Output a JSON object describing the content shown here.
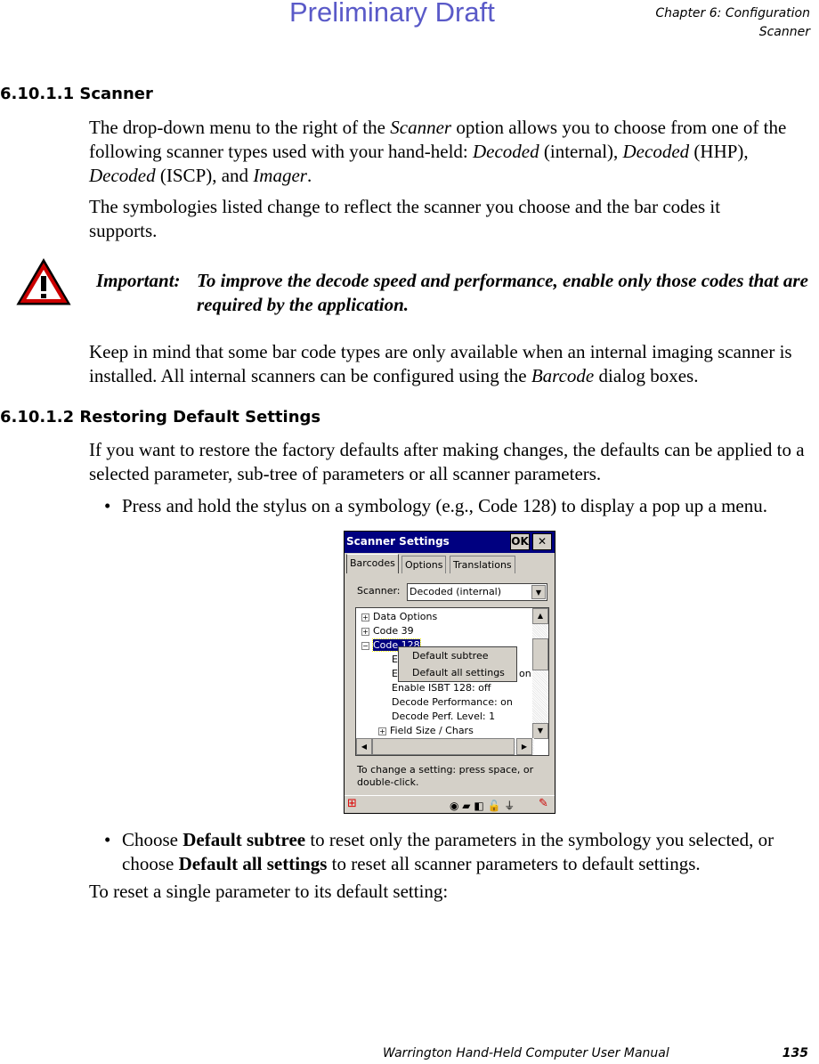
{
  "header": {
    "draft": "Preliminary Draft",
    "chapter": "Chapter 6:  Configuration",
    "section": "Scanner"
  },
  "s1": {
    "heading": "6.10.1.1  Scanner",
    "p1": [
      "The drop-down menu to the right of the ",
      "Scanner",
      " option allows you to choose from one of the following scanner types used with your hand-held: ",
      "Decoded",
      " (internal), ",
      "Decoded",
      " (HHP), ",
      "Decoded",
      " (ISCP), and ",
      "Imager",
      "."
    ],
    "p2": "The symbologies listed change to reflect the scanner you choose and the bar codes it supports.",
    "important_label": "Important:",
    "important_text": "To improve the decode speed and performance, enable only those codes that are required by the application.",
    "p3": [
      "Keep in mind that some bar code types are only available when an internal imaging scanner is installed. All internal scanners can be configured using the ",
      "Barcode",
      " dialog boxes."
    ]
  },
  "s2": {
    "heading": "6.10.1.2  Restoring Default Settings",
    "p1": "If you want to restore the factory defaults after making changes, the defaults can be applied to a selected parameter, sub-tree of parameters or all scanner parameters.",
    "bullet1": "Press and hold the stylus on a symbology (e.g., Code 128) to display a pop up a menu.",
    "bullet2": [
      "Choose ",
      "Default subtree",
      " to reset only the parameters in the symbology you selected, or choose ",
      "Default all settings",
      " to reset all scanner parameters to default settings."
    ],
    "p2": "To reset a single parameter to its default setting:"
  },
  "screenshot": {
    "title": "Scanner Settings",
    "ok": "OK",
    "close": "✕",
    "tabs": [
      "Barcodes",
      "Options",
      "Translations"
    ],
    "scanner_label": "Scanner:",
    "scanner_value": "Decoded (internal)",
    "tree": [
      "Data Options",
      "Code 39",
      "Code 128",
      "E",
      "E",
      "Enable ISBT 128: off",
      "Decode Performance: on",
      "Decode Perf. Level: 1",
      "Field Size / Chars"
    ],
    "tree_tail": "on",
    "menu": [
      "Default subtree",
      "Default all settings"
    ],
    "hint": "To change a setting: press space, or double-click."
  },
  "footer": {
    "manual": "Warrington Hand-Held Computer User Manual",
    "page": "135"
  },
  "colors": {
    "draft": "#5a5ac8",
    "titlebar": "#000080",
    "selection": "#000080"
  }
}
